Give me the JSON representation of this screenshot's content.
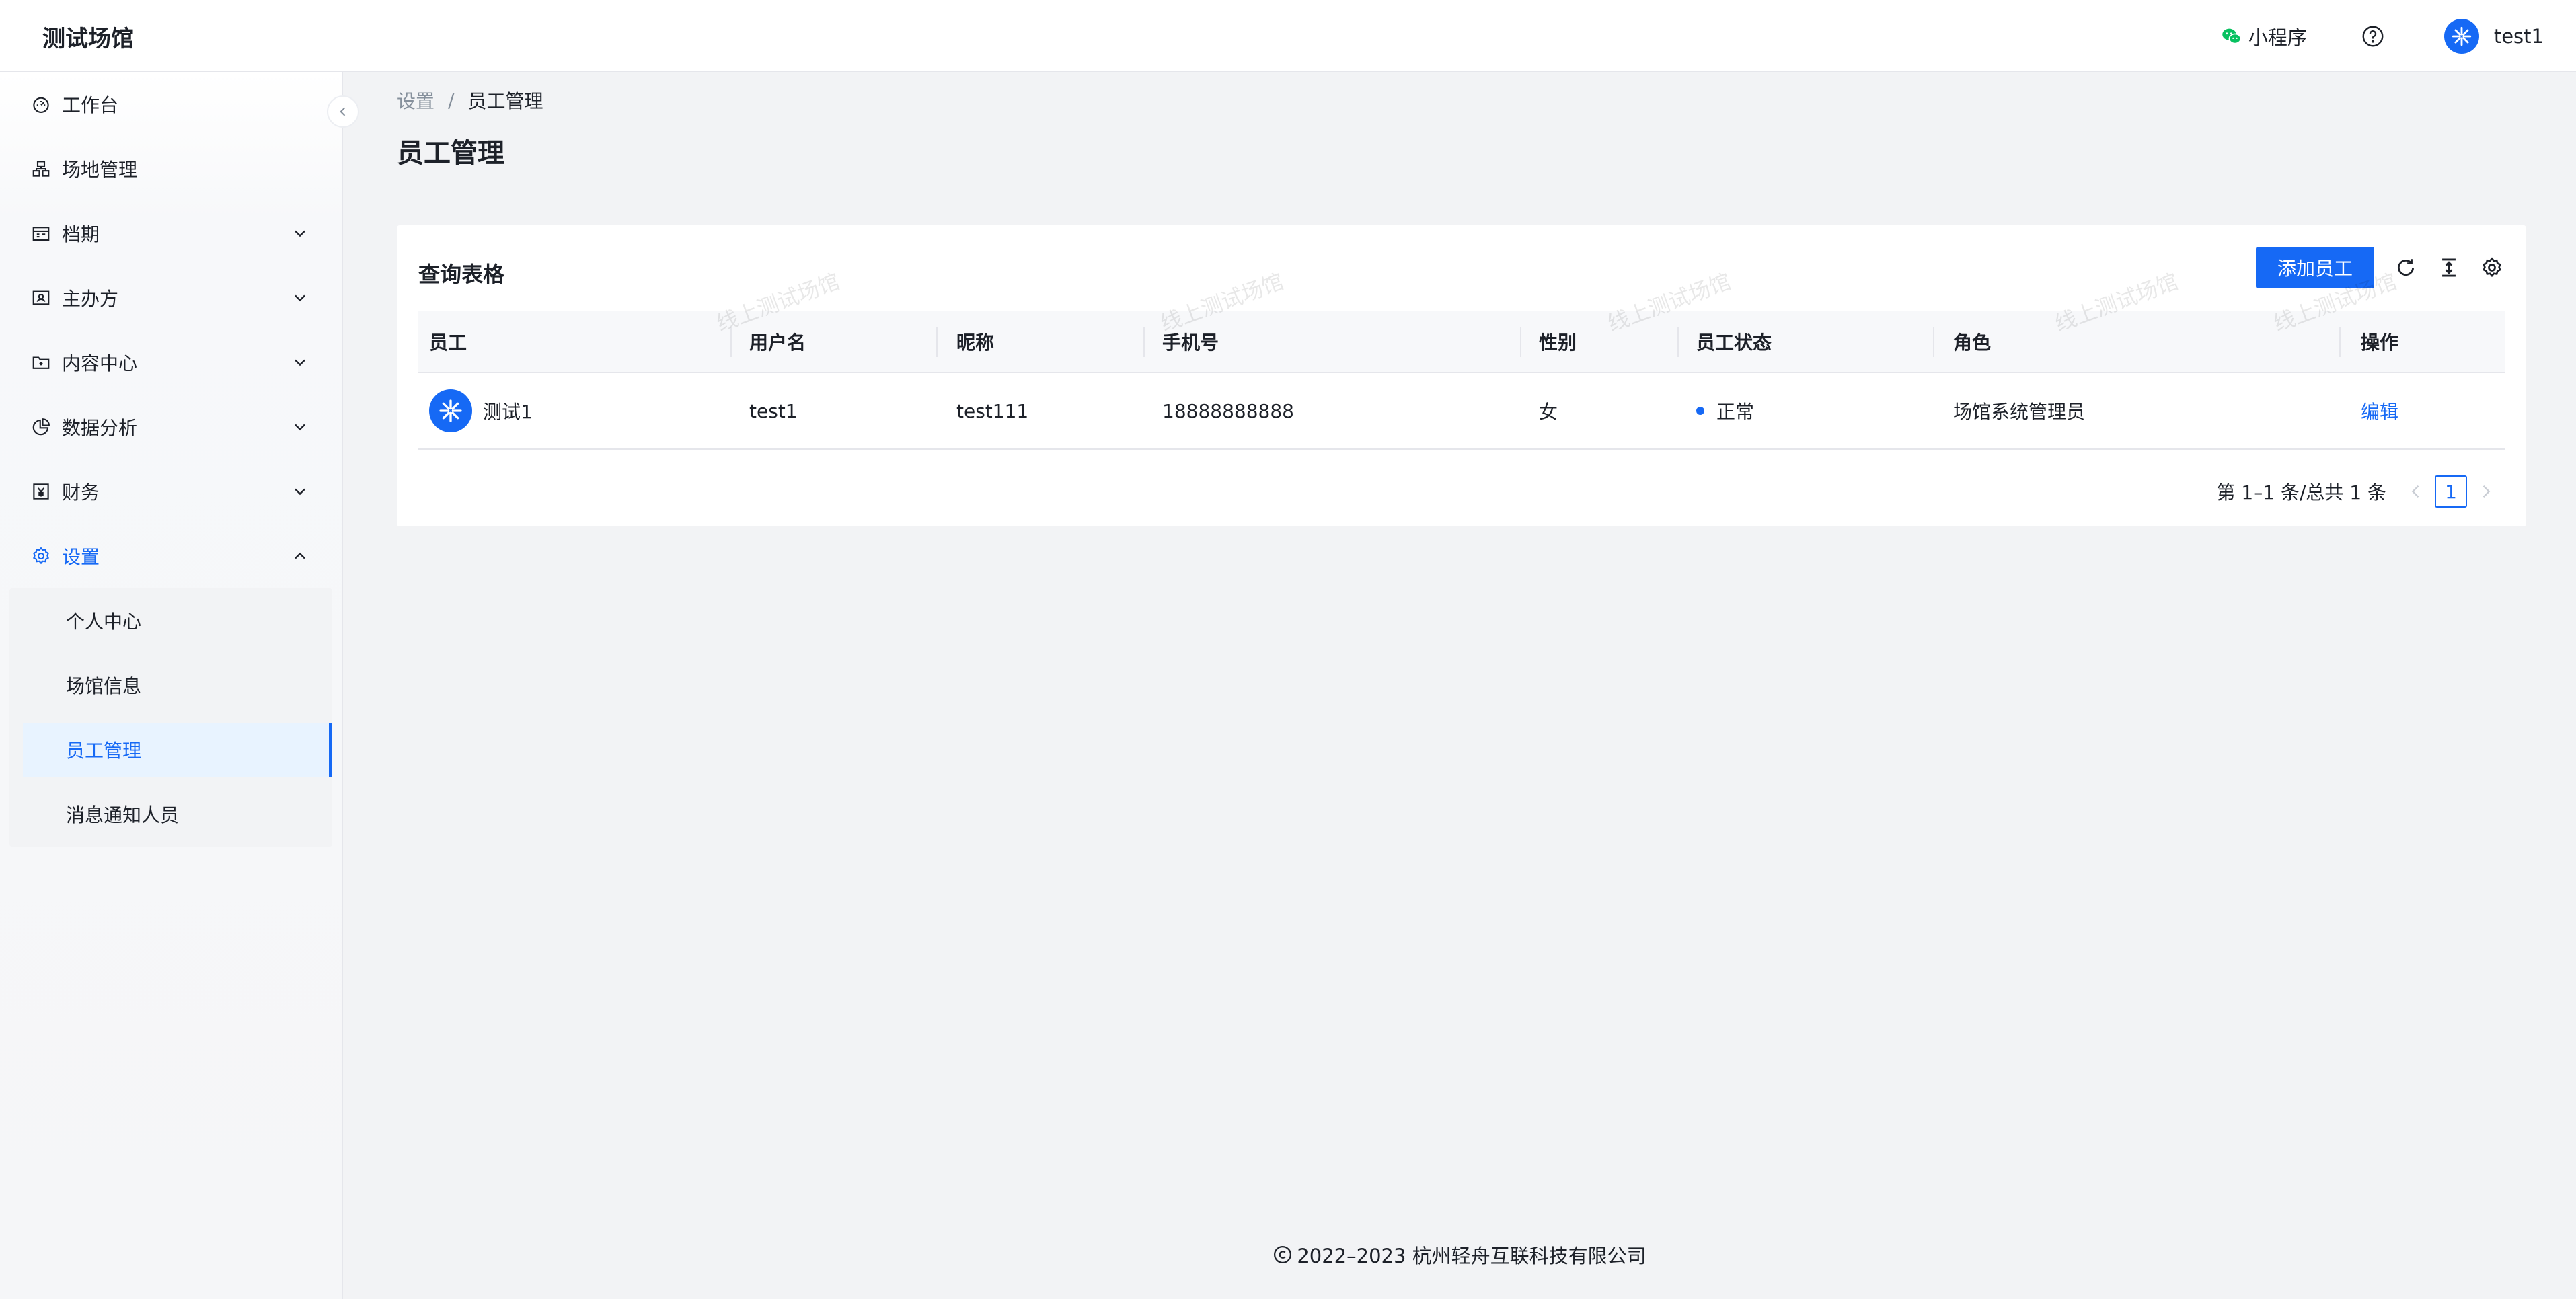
{
  "app": {
    "title": "测试场馆"
  },
  "header": {
    "mini_program": "小程序",
    "user_name": "test1"
  },
  "sidebar": {
    "items": [
      {
        "label": "工作台",
        "icon": "dashboard-icon"
      },
      {
        "label": "场地管理",
        "icon": "venue-icon"
      },
      {
        "label": "档期",
        "icon": "schedule-icon"
      },
      {
        "label": "主办方",
        "icon": "organizer-icon"
      },
      {
        "label": "内容中心",
        "icon": "folder-icon"
      },
      {
        "label": "数据分析",
        "icon": "pie-chart-icon"
      },
      {
        "label": "财务",
        "icon": "finance-icon"
      },
      {
        "label": "设置",
        "icon": "settings-icon"
      }
    ],
    "sub_items": [
      {
        "label": "个人中心"
      },
      {
        "label": "场馆信息"
      },
      {
        "label": "员工管理"
      },
      {
        "label": "消息通知人员"
      }
    ]
  },
  "breadcrumb": {
    "parent": "设置",
    "separator": "/",
    "current": "员工管理"
  },
  "page": {
    "title": "员工管理"
  },
  "card": {
    "title": "查询表格",
    "add_button": "添加员工"
  },
  "table": {
    "columns": [
      "员工",
      "用户名",
      "昵称",
      "手机号",
      "性别",
      "员工状态",
      "角色",
      "操作"
    ],
    "rows": [
      {
        "employee": "测试1",
        "username": "test1",
        "nickname": "test111",
        "phone": "18888888888",
        "gender": "女",
        "status": "正常",
        "role": "场馆系统管理员",
        "action": "编辑"
      }
    ]
  },
  "pagination": {
    "summary": "第 1–1 条/总共 1 条",
    "current_page": "1"
  },
  "watermark": "线上测试场馆",
  "footer": {
    "copyright": "2022–2023 杭州轻舟互联科技有限公司"
  },
  "colors": {
    "primary": "#1669f5",
    "wechat": "#07c160"
  }
}
